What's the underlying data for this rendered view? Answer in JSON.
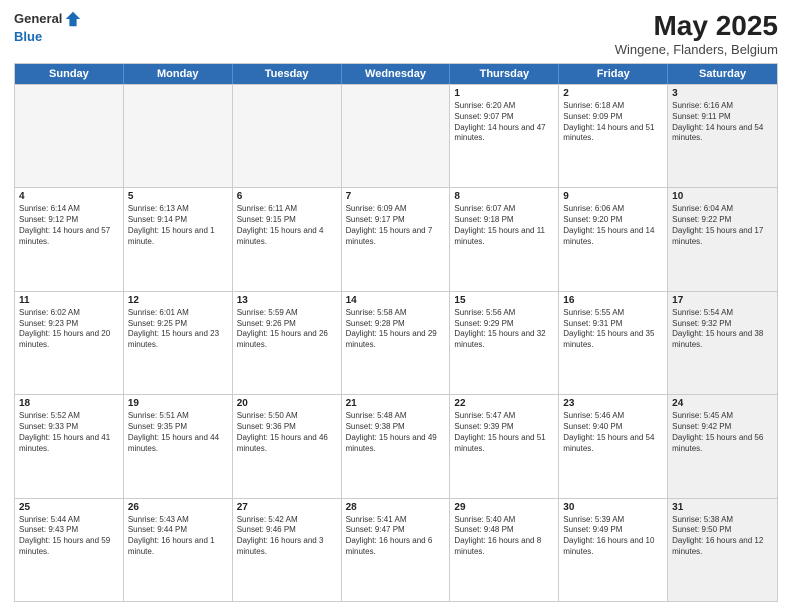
{
  "header": {
    "logo_line1": "General",
    "logo_line2": "Blue",
    "title": "May 2025",
    "location": "Wingene, Flanders, Belgium"
  },
  "days_of_week": [
    "Sunday",
    "Monday",
    "Tuesday",
    "Wednesday",
    "Thursday",
    "Friday",
    "Saturday"
  ],
  "weeks": [
    [
      {
        "day": "",
        "sunrise": "",
        "sunset": "",
        "daylight": "",
        "shaded": true
      },
      {
        "day": "",
        "sunrise": "",
        "sunset": "",
        "daylight": "",
        "shaded": true
      },
      {
        "day": "",
        "sunrise": "",
        "sunset": "",
        "daylight": "",
        "shaded": true
      },
      {
        "day": "",
        "sunrise": "",
        "sunset": "",
        "daylight": "",
        "shaded": true
      },
      {
        "day": "1",
        "sunrise": "Sunrise: 6:20 AM",
        "sunset": "Sunset: 9:07 PM",
        "daylight": "Daylight: 14 hours and 47 minutes.",
        "shaded": false
      },
      {
        "day": "2",
        "sunrise": "Sunrise: 6:18 AM",
        "sunset": "Sunset: 9:09 PM",
        "daylight": "Daylight: 14 hours and 51 minutes.",
        "shaded": false
      },
      {
        "day": "3",
        "sunrise": "Sunrise: 6:16 AM",
        "sunset": "Sunset: 9:11 PM",
        "daylight": "Daylight: 14 hours and 54 minutes.",
        "shaded": true
      }
    ],
    [
      {
        "day": "4",
        "sunrise": "Sunrise: 6:14 AM",
        "sunset": "Sunset: 9:12 PM",
        "daylight": "Daylight: 14 hours and 57 minutes.",
        "shaded": false
      },
      {
        "day": "5",
        "sunrise": "Sunrise: 6:13 AM",
        "sunset": "Sunset: 9:14 PM",
        "daylight": "Daylight: 15 hours and 1 minute.",
        "shaded": false
      },
      {
        "day": "6",
        "sunrise": "Sunrise: 6:11 AM",
        "sunset": "Sunset: 9:15 PM",
        "daylight": "Daylight: 15 hours and 4 minutes.",
        "shaded": false
      },
      {
        "day": "7",
        "sunrise": "Sunrise: 6:09 AM",
        "sunset": "Sunset: 9:17 PM",
        "daylight": "Daylight: 15 hours and 7 minutes.",
        "shaded": false
      },
      {
        "day": "8",
        "sunrise": "Sunrise: 6:07 AM",
        "sunset": "Sunset: 9:18 PM",
        "daylight": "Daylight: 15 hours and 11 minutes.",
        "shaded": false
      },
      {
        "day": "9",
        "sunrise": "Sunrise: 6:06 AM",
        "sunset": "Sunset: 9:20 PM",
        "daylight": "Daylight: 15 hours and 14 minutes.",
        "shaded": false
      },
      {
        "day": "10",
        "sunrise": "Sunrise: 6:04 AM",
        "sunset": "Sunset: 9:22 PM",
        "daylight": "Daylight: 15 hours and 17 minutes.",
        "shaded": true
      }
    ],
    [
      {
        "day": "11",
        "sunrise": "Sunrise: 6:02 AM",
        "sunset": "Sunset: 9:23 PM",
        "daylight": "Daylight: 15 hours and 20 minutes.",
        "shaded": false
      },
      {
        "day": "12",
        "sunrise": "Sunrise: 6:01 AM",
        "sunset": "Sunset: 9:25 PM",
        "daylight": "Daylight: 15 hours and 23 minutes.",
        "shaded": false
      },
      {
        "day": "13",
        "sunrise": "Sunrise: 5:59 AM",
        "sunset": "Sunset: 9:26 PM",
        "daylight": "Daylight: 15 hours and 26 minutes.",
        "shaded": false
      },
      {
        "day": "14",
        "sunrise": "Sunrise: 5:58 AM",
        "sunset": "Sunset: 9:28 PM",
        "daylight": "Daylight: 15 hours and 29 minutes.",
        "shaded": false
      },
      {
        "day": "15",
        "sunrise": "Sunrise: 5:56 AM",
        "sunset": "Sunset: 9:29 PM",
        "daylight": "Daylight: 15 hours and 32 minutes.",
        "shaded": false
      },
      {
        "day": "16",
        "sunrise": "Sunrise: 5:55 AM",
        "sunset": "Sunset: 9:31 PM",
        "daylight": "Daylight: 15 hours and 35 minutes.",
        "shaded": false
      },
      {
        "day": "17",
        "sunrise": "Sunrise: 5:54 AM",
        "sunset": "Sunset: 9:32 PM",
        "daylight": "Daylight: 15 hours and 38 minutes.",
        "shaded": true
      }
    ],
    [
      {
        "day": "18",
        "sunrise": "Sunrise: 5:52 AM",
        "sunset": "Sunset: 9:33 PM",
        "daylight": "Daylight: 15 hours and 41 minutes.",
        "shaded": false
      },
      {
        "day": "19",
        "sunrise": "Sunrise: 5:51 AM",
        "sunset": "Sunset: 9:35 PM",
        "daylight": "Daylight: 15 hours and 44 minutes.",
        "shaded": false
      },
      {
        "day": "20",
        "sunrise": "Sunrise: 5:50 AM",
        "sunset": "Sunset: 9:36 PM",
        "daylight": "Daylight: 15 hours and 46 minutes.",
        "shaded": false
      },
      {
        "day": "21",
        "sunrise": "Sunrise: 5:48 AM",
        "sunset": "Sunset: 9:38 PM",
        "daylight": "Daylight: 15 hours and 49 minutes.",
        "shaded": false
      },
      {
        "day": "22",
        "sunrise": "Sunrise: 5:47 AM",
        "sunset": "Sunset: 9:39 PM",
        "daylight": "Daylight: 15 hours and 51 minutes.",
        "shaded": false
      },
      {
        "day": "23",
        "sunrise": "Sunrise: 5:46 AM",
        "sunset": "Sunset: 9:40 PM",
        "daylight": "Daylight: 15 hours and 54 minutes.",
        "shaded": false
      },
      {
        "day": "24",
        "sunrise": "Sunrise: 5:45 AM",
        "sunset": "Sunset: 9:42 PM",
        "daylight": "Daylight: 15 hours and 56 minutes.",
        "shaded": true
      }
    ],
    [
      {
        "day": "25",
        "sunrise": "Sunrise: 5:44 AM",
        "sunset": "Sunset: 9:43 PM",
        "daylight": "Daylight: 15 hours and 59 minutes.",
        "shaded": false
      },
      {
        "day": "26",
        "sunrise": "Sunrise: 5:43 AM",
        "sunset": "Sunset: 9:44 PM",
        "daylight": "Daylight: 16 hours and 1 minute.",
        "shaded": false
      },
      {
        "day": "27",
        "sunrise": "Sunrise: 5:42 AM",
        "sunset": "Sunset: 9:46 PM",
        "daylight": "Daylight: 16 hours and 3 minutes.",
        "shaded": false
      },
      {
        "day": "28",
        "sunrise": "Sunrise: 5:41 AM",
        "sunset": "Sunset: 9:47 PM",
        "daylight": "Daylight: 16 hours and 6 minutes.",
        "shaded": false
      },
      {
        "day": "29",
        "sunrise": "Sunrise: 5:40 AM",
        "sunset": "Sunset: 9:48 PM",
        "daylight": "Daylight: 16 hours and 8 minutes.",
        "shaded": false
      },
      {
        "day": "30",
        "sunrise": "Sunrise: 5:39 AM",
        "sunset": "Sunset: 9:49 PM",
        "daylight": "Daylight: 16 hours and 10 minutes.",
        "shaded": false
      },
      {
        "day": "31",
        "sunrise": "Sunrise: 5:38 AM",
        "sunset": "Sunset: 9:50 PM",
        "daylight": "Daylight: 16 hours and 12 minutes.",
        "shaded": true
      }
    ]
  ]
}
